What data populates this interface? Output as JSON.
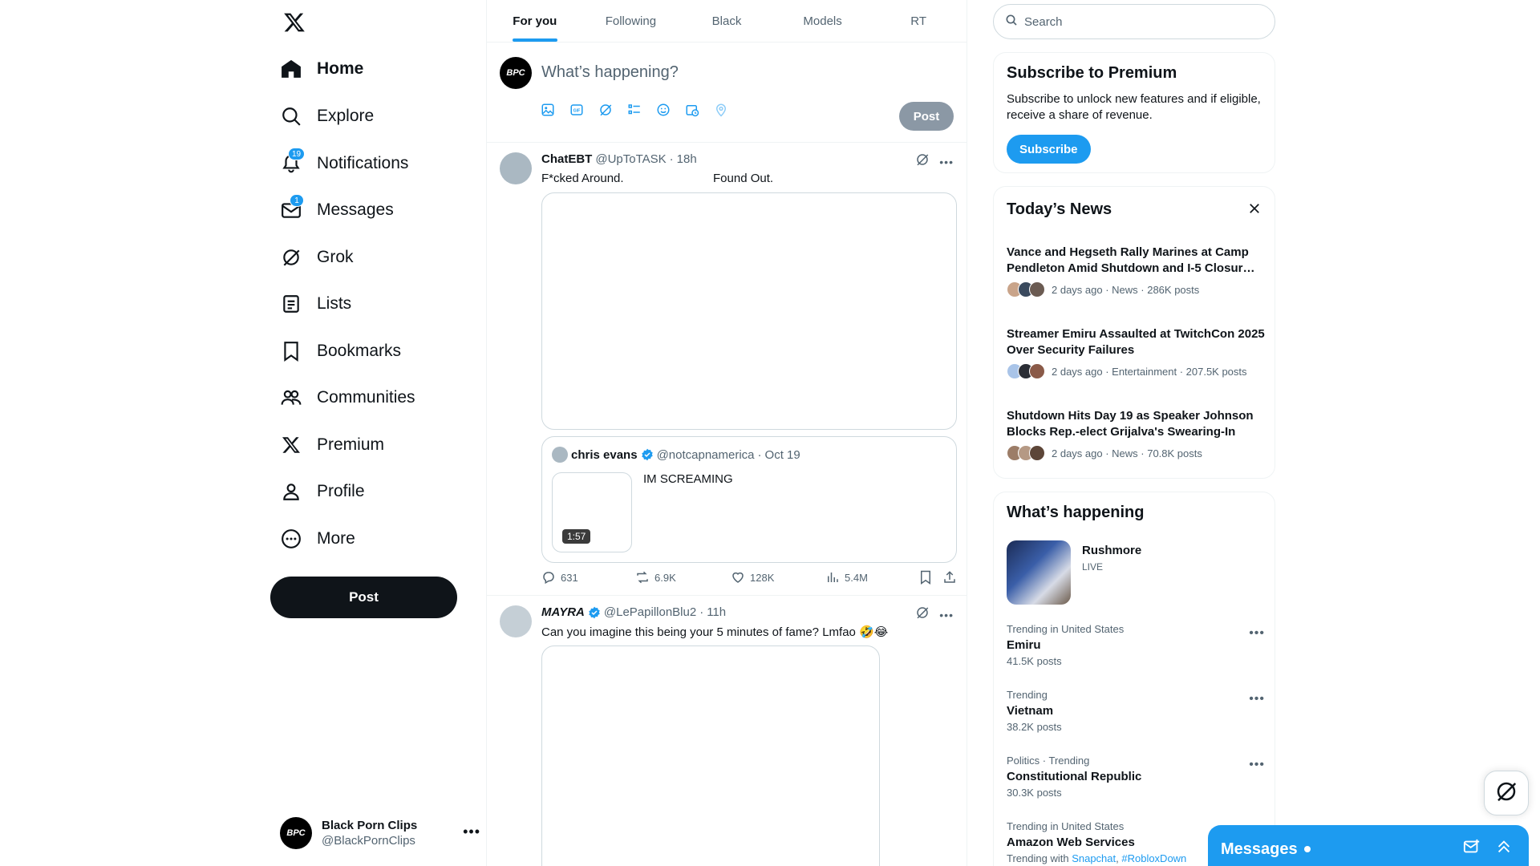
{
  "nav": {
    "items": [
      {
        "label": "Home",
        "icon": "home-icon"
      },
      {
        "label": "Explore",
        "icon": "search-icon"
      },
      {
        "label": "Notifications",
        "icon": "bell-icon",
        "badge": "19"
      },
      {
        "label": "Messages",
        "icon": "envelope-icon",
        "badge": "1"
      },
      {
        "label": "Grok",
        "icon": "grok-icon"
      },
      {
        "label": "Lists",
        "icon": "list-icon"
      },
      {
        "label": "Bookmarks",
        "icon": "bookmark-icon"
      },
      {
        "label": "Communities",
        "icon": "people-icon"
      },
      {
        "label": "Premium",
        "icon": "x-icon"
      },
      {
        "label": "Profile",
        "icon": "person-icon"
      },
      {
        "label": "More",
        "icon": "more-circle-icon"
      }
    ],
    "post_label": "Post",
    "account": {
      "avatar_text": "BPC",
      "name": "Black Porn Clips",
      "handle": "@BlackPornClips"
    }
  },
  "tabs": [
    "For you",
    "Following",
    "Black",
    "Models",
    "RT"
  ],
  "composer": {
    "avatar_text": "BPC",
    "placeholder": "What’s happening?",
    "post_label": "Post"
  },
  "tweets": [
    {
      "name": "ChatEBT",
      "handle": "@UpToTASK",
      "time": "18h",
      "text_left": "F*cked Around.",
      "text_right": "Found Out.",
      "quote": {
        "name": "chris evans",
        "handle": "@notcapnamerica",
        "time": "Oct 19",
        "text": "IM SCREAMING",
        "duration": "1:57"
      },
      "actions": {
        "replies": "631",
        "reposts": "6.9K",
        "likes": "128K",
        "views": "5.4M"
      }
    },
    {
      "name": "MAYRA",
      "handle": "@LePapillonBlu2",
      "time": "11h",
      "text": "Can you imagine this being your 5 minutes of fame? Lmfao 🤣😂"
    }
  ],
  "search": {
    "placeholder": "Search"
  },
  "premium": {
    "title": "Subscribe to Premium",
    "desc": "Subscribe to unlock new features and if eligible, receive a share of revenue.",
    "button": "Subscribe"
  },
  "news": {
    "title": "Today’s News",
    "items": [
      {
        "title": "Vance and Hegseth Rally Marines at Camp Pendleton Amid Shutdown and I-5 Closur…",
        "meta": "2 days ago · News · 286K posts"
      },
      {
        "title": "Streamer Emiru Assaulted at TwitchCon 2025 Over Security Failures",
        "meta": "2 days ago · Entertainment · 207.5K posts"
      },
      {
        "title": "Shutdown Hits Day 19 as Speaker Johnson Blocks Rep.-elect Grijalva's Swearing-In",
        "meta": "2 days ago · News · 70.8K posts"
      }
    ]
  },
  "happening": {
    "title": "What’s happening",
    "live": {
      "name": "Rushmore",
      "status": "LIVE"
    },
    "trends": [
      {
        "context": "Trending in United States",
        "name": "Emiru",
        "count": "41.5K posts"
      },
      {
        "context": "Trending",
        "name": "Vietnam",
        "count": "38.2K posts"
      },
      {
        "context": "Politics · Trending",
        "name": "Constitutional Republic",
        "count": "30.3K posts"
      },
      {
        "context": "Trending in United States",
        "name": "Amazon Web Services",
        "with_prefix": "Trending with",
        "with1": "Snapchat",
        "with2": "#RobloxDown"
      }
    ]
  },
  "dock": {
    "title": "Messages"
  },
  "colors": {
    "accent": "#1d9bf0",
    "text": "#0f1419",
    "muted": "#536471"
  }
}
